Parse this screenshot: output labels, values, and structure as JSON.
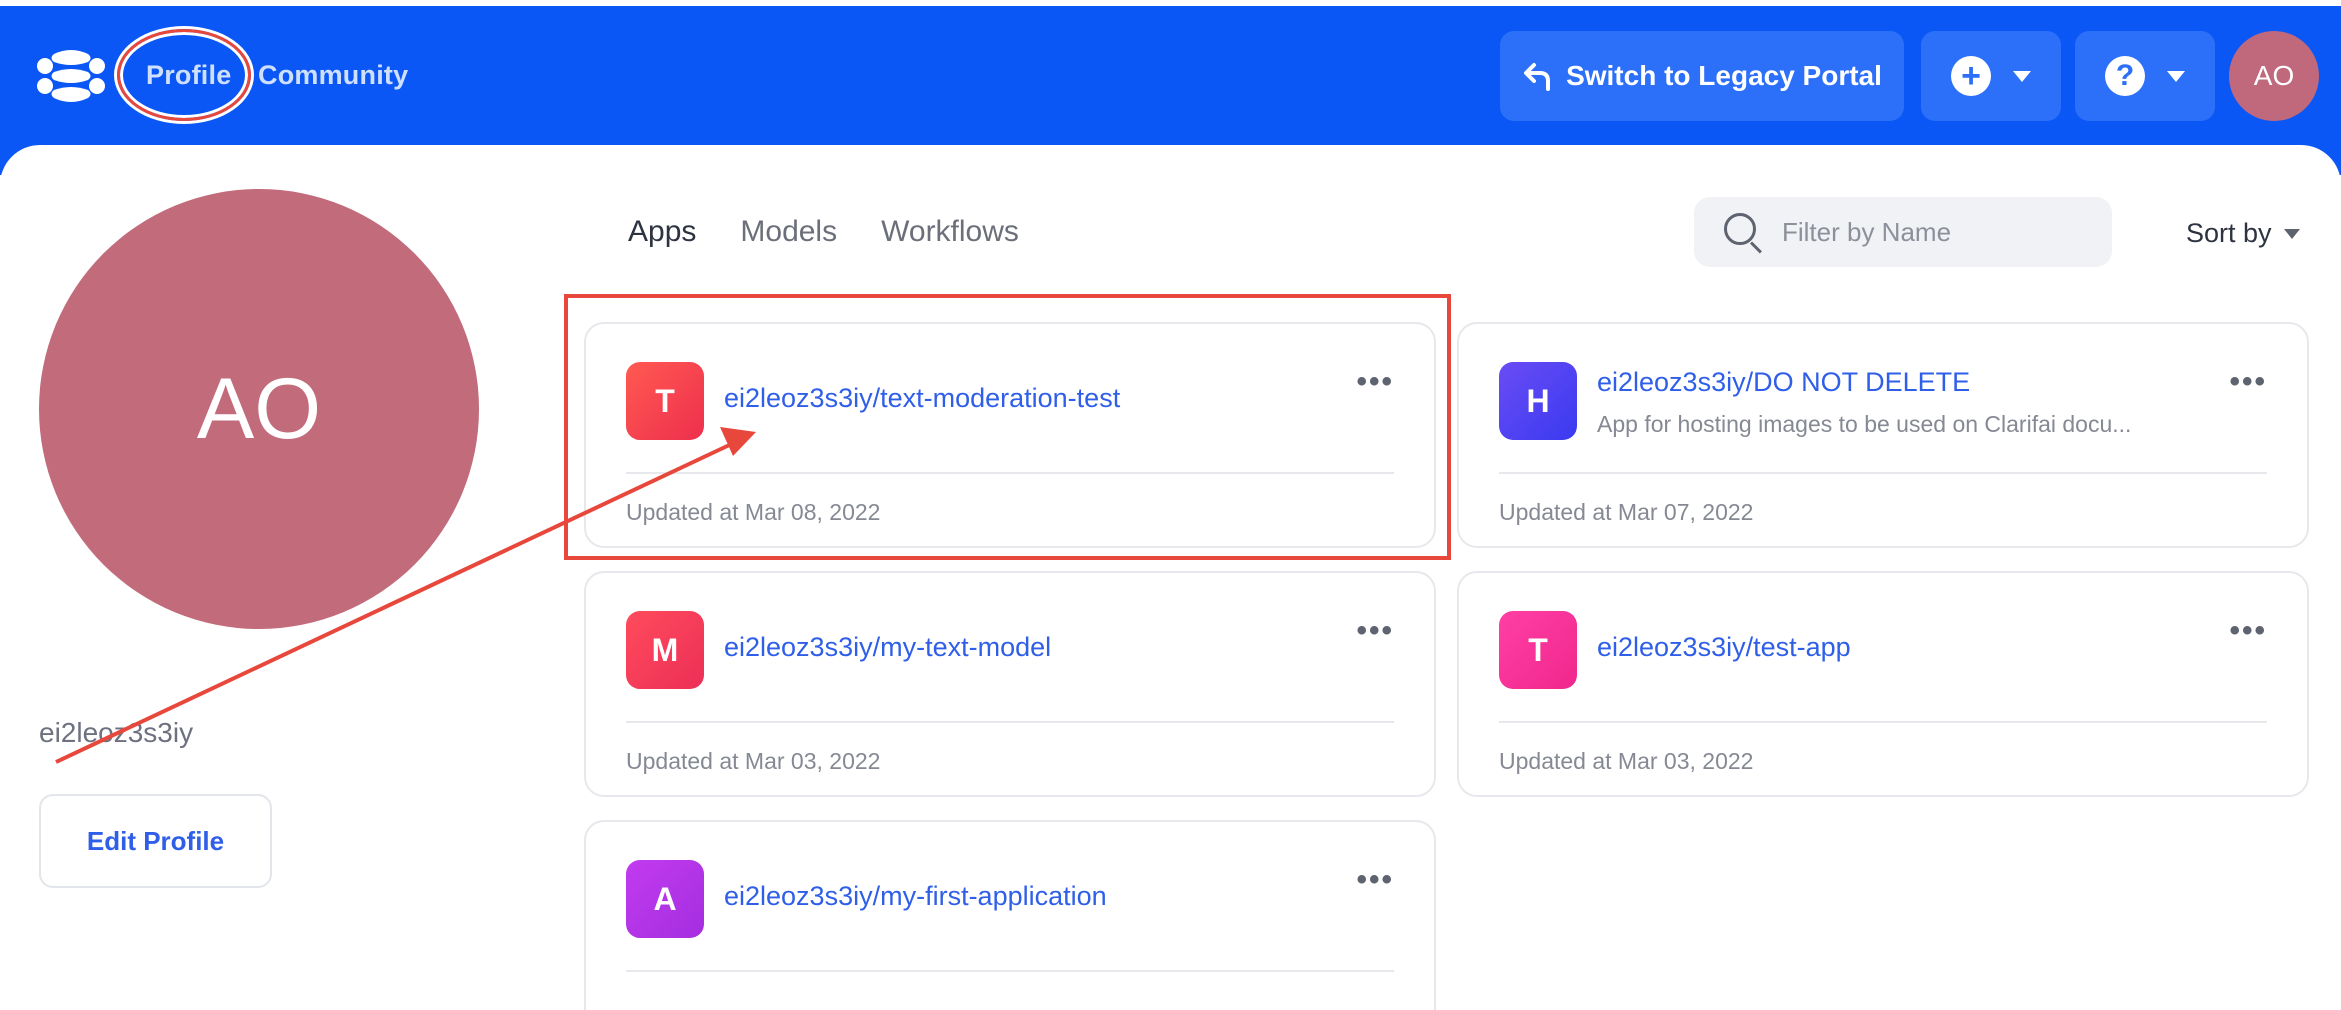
{
  "header": {
    "nav": [
      {
        "label": "Profile"
      },
      {
        "label": "Community"
      }
    ],
    "legacy_button": "Switch to Legacy Portal",
    "user_initials": "AO",
    "bar_color": "#0b57f5"
  },
  "profile": {
    "initials": "AO",
    "username": "ei2leoz3s3iy",
    "edit_label": "Edit Profile",
    "avatar_color": "#c16b7b"
  },
  "tabs": [
    {
      "label": "Apps",
      "active": true
    },
    {
      "label": "Models",
      "active": false
    },
    {
      "label": "Workflows",
      "active": false
    }
  ],
  "filter": {
    "placeholder": "Filter by Name"
  },
  "sort": {
    "label": "Sort by"
  },
  "apps": [
    {
      "letter": "T",
      "title": "ei2leoz3s3iy/text-moderation-test",
      "description": "",
      "updated": "Updated at Mar 08, 2022",
      "icon_gradient": [
        "#ff5a52",
        "#ee2f4d"
      ]
    },
    {
      "letter": "H",
      "title": "ei2leoz3s3iy/DO NOT DELETE",
      "description": "App for hosting images to be used on Clarifai docu...",
      "updated": "Updated at Mar 07, 2022",
      "icon_gradient": [
        "#6a4cf5",
        "#3a3af0"
      ]
    },
    {
      "letter": "M",
      "title": "ei2leoz3s3iy/my-text-model",
      "description": "",
      "updated": "Updated at Mar 03, 2022",
      "icon_gradient": [
        "#ff4b5c",
        "#ec2f57"
      ]
    },
    {
      "letter": "T",
      "title": "ei2leoz3s3iy/test-app",
      "description": "",
      "updated": "Updated at Mar 03, 2022",
      "icon_gradient": [
        "#ff3fa5",
        "#f0278c"
      ]
    },
    {
      "letter": "A",
      "title": "ei2leoz3s3iy/my-first-application",
      "description": "",
      "updated": "",
      "icon_gradient": [
        "#c23bf0",
        "#a52ee0"
      ]
    }
  ],
  "colors": {
    "accent": "#2f5ee8",
    "annotation": "#e8473c"
  }
}
